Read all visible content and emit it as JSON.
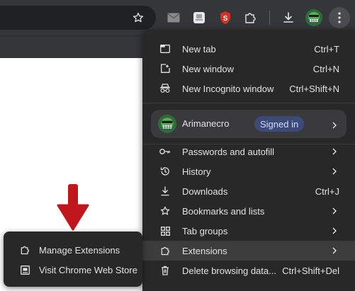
{
  "toolbar": {
    "icons": [
      "star-icon",
      "mail-icon",
      "notes-icon",
      "shield-extension-icon",
      "puzzle-icon",
      "download-icon",
      "profile-avatar",
      "kebab-menu-icon"
    ]
  },
  "menu": {
    "items": [
      {
        "label": "New tab",
        "shortcut": "Ctrl+T",
        "icon": "new-tab-icon"
      },
      {
        "label": "New window",
        "shortcut": "Ctrl+N",
        "icon": "new-window-icon"
      },
      {
        "label": "New Incognito window",
        "shortcut": "Ctrl+Shift+N",
        "icon": "incognito-icon"
      }
    ],
    "profile": {
      "name": "Arimanecro",
      "status": "Signed in"
    },
    "items2": [
      {
        "label": "Passwords and autofill",
        "icon": "key-icon",
        "submenu": true
      },
      {
        "label": "History",
        "icon": "history-icon",
        "submenu": true
      },
      {
        "label": "Downloads",
        "shortcut": "Ctrl+J",
        "icon": "download-icon"
      },
      {
        "label": "Bookmarks and lists",
        "icon": "star-icon",
        "submenu": true
      },
      {
        "label": "Tab groups",
        "icon": "tab-groups-icon",
        "submenu": true
      },
      {
        "label": "Extensions",
        "icon": "puzzle-icon",
        "submenu": true
      },
      {
        "label": "Delete browsing data...",
        "shortcut": "Ctrl+Shift+Del",
        "icon": "trash-icon"
      }
    ]
  },
  "submenu": {
    "items": [
      {
        "label": "Manage Extensions",
        "icon": "puzzle-icon"
      },
      {
        "label": "Visit Chrome Web Store",
        "icon": "web-store-icon"
      }
    ]
  },
  "colors": {
    "toolbar": "#35363a",
    "menu_bg": "#282828",
    "hover": "#3c3c3c",
    "badge": "#3c4a7a",
    "arrow": "#c0161c"
  }
}
